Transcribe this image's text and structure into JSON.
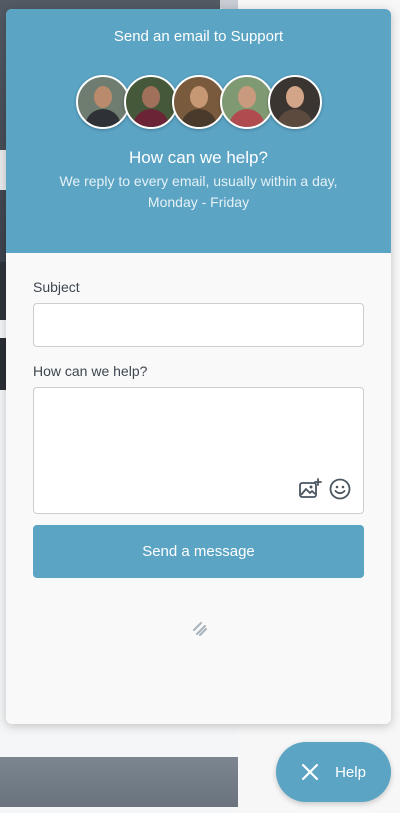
{
  "widget": {
    "title": "Send an email to Support",
    "avatars": [
      "team-member",
      "team-member",
      "team-member",
      "team-member",
      "team-member"
    ],
    "heading": "How can we help?",
    "subheading": "We reply to every email, usually within a day, Monday - Friday",
    "accent_color": "#5ba4c4"
  },
  "form": {
    "subject_label": "Subject",
    "subject_value": "",
    "message_label": "How can we help?",
    "message_value": "",
    "send_label": "Send a message"
  },
  "icons": {
    "attach": "image-add-icon",
    "emoji": "emoji-icon",
    "brand": "brand-mark-icon",
    "close": "close-icon"
  },
  "launcher": {
    "label": "Help"
  }
}
